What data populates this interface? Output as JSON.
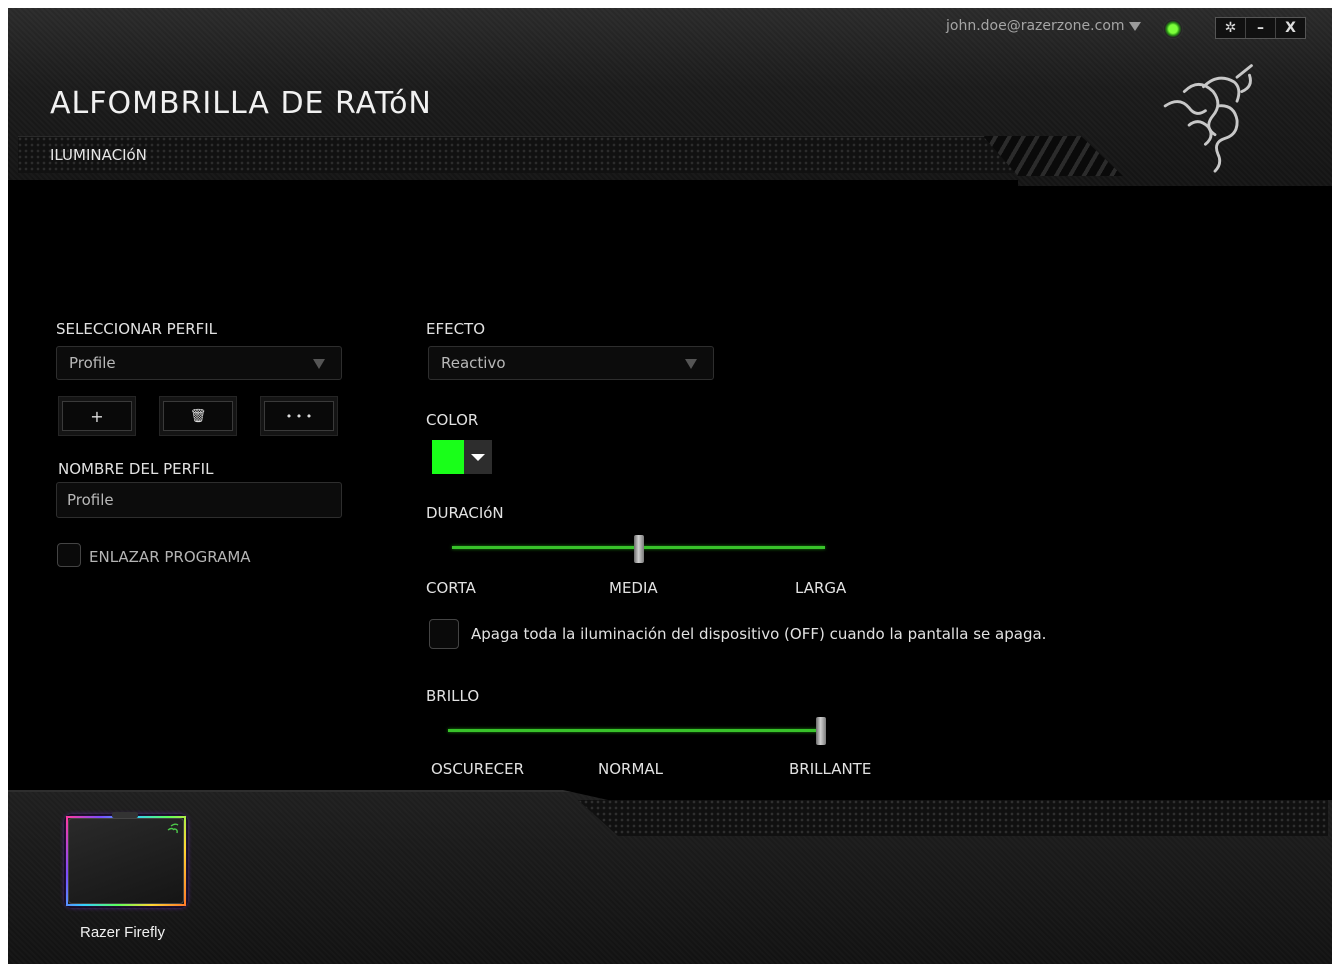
{
  "topbar": {
    "user_email": "john.doe@razerzone.com",
    "settings_label": "✲",
    "minimize_label": "–",
    "close_label": "X"
  },
  "header": {
    "title": "ALFOMBRILLA DE RATóN",
    "section": "ILUMINACIóN"
  },
  "profile": {
    "select_label": "SELECCIONAR PERFIL",
    "selected": "Profile",
    "add_label": "+",
    "delete_label": "🗑",
    "more_label": "• • •",
    "name_label": "NOMBRE DEL PERFIL",
    "name_value": "Profile",
    "link_program_label": "ENLAZAR PROGRAMA"
  },
  "effect": {
    "label": "EFECTO",
    "selected": "Reactivo"
  },
  "color": {
    "label": "COLOR",
    "value": "#19ff19"
  },
  "duration": {
    "label": "DURACIóN",
    "level": 0.5,
    "marks": [
      "CORTA",
      "MEDIA",
      "LARGA"
    ]
  },
  "screen_off": {
    "label": "Apaga toda la iluminación del dispositivo (OFF) cuando la pantalla se apaga."
  },
  "brightness": {
    "label": "BRILLO",
    "level": 1.0,
    "marks": [
      "OSCURECER",
      "NORMAL",
      "BRILLANTE"
    ]
  },
  "devices": [
    {
      "name": "Razer Firefly"
    }
  ]
}
